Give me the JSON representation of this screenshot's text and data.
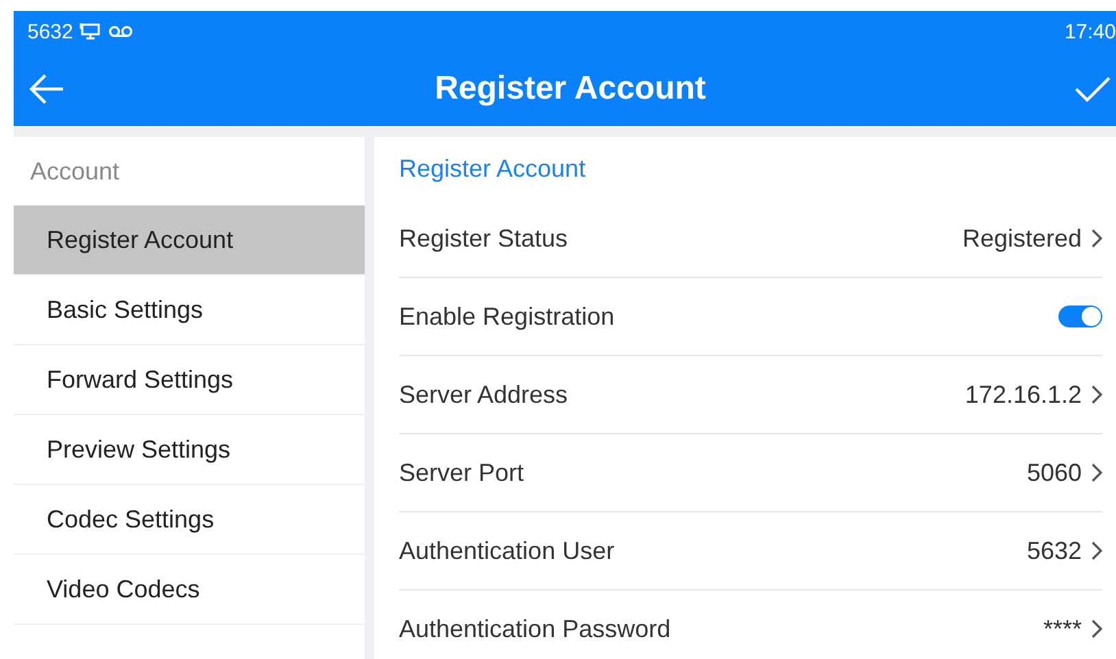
{
  "status_bar": {
    "extension": "5632",
    "time": "17:40"
  },
  "header": {
    "title": "Register Account"
  },
  "sidebar": {
    "heading": "Account",
    "items": [
      {
        "label": "Register Account",
        "selected": true
      },
      {
        "label": "Basic Settings",
        "selected": false
      },
      {
        "label": "Forward Settings",
        "selected": false
      },
      {
        "label": "Preview Settings",
        "selected": false
      },
      {
        "label": "Codec Settings",
        "selected": false
      },
      {
        "label": "Video Codecs",
        "selected": false
      }
    ]
  },
  "panel": {
    "section_title": "Register Account",
    "rows": [
      {
        "kind": "value",
        "label": "Register Status",
        "value": "Registered"
      },
      {
        "kind": "toggle",
        "label": "Enable Registration",
        "on": true
      },
      {
        "kind": "value",
        "label": "Server Address",
        "value": "172.16.1.2"
      },
      {
        "kind": "value",
        "label": "Server Port",
        "value": "5060"
      },
      {
        "kind": "value",
        "label": "Authentication User",
        "value": "5632"
      },
      {
        "kind": "value",
        "label": "Authentication Password",
        "value": "****"
      }
    ]
  }
}
